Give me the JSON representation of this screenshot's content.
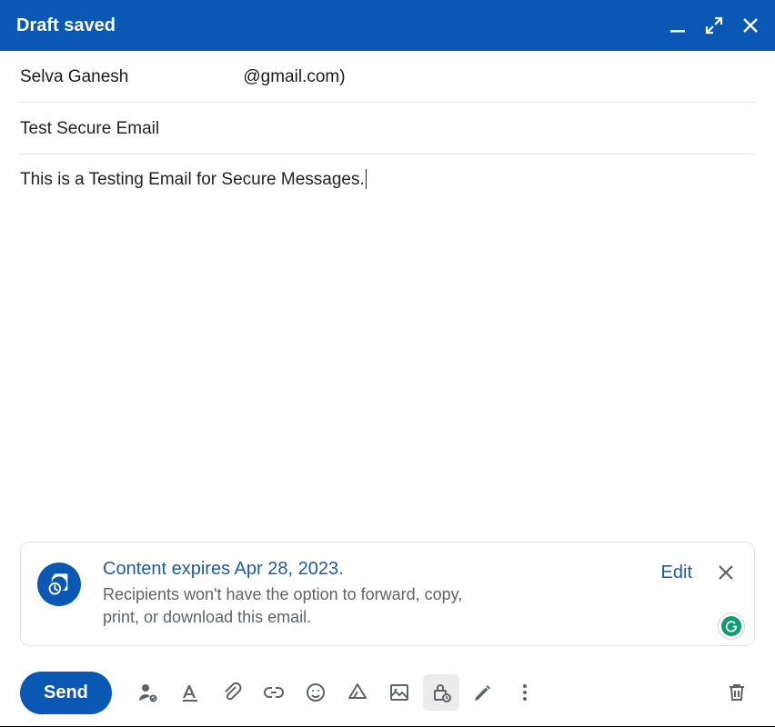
{
  "titlebar": {
    "title": "Draft saved"
  },
  "recipient": {
    "name": "Selva Ganesh",
    "email_suffix": "@gmail.com)"
  },
  "subject": "Test Secure Email",
  "body": "This is a Testing Email for Secure Messages.",
  "confidential": {
    "title": "Content expires Apr 28, 2023.",
    "subtitle": "Recipients won't have the option to forward, copy, print, or download this email.",
    "edit_label": "Edit"
  },
  "toolbar": {
    "send_label": "Send"
  }
}
